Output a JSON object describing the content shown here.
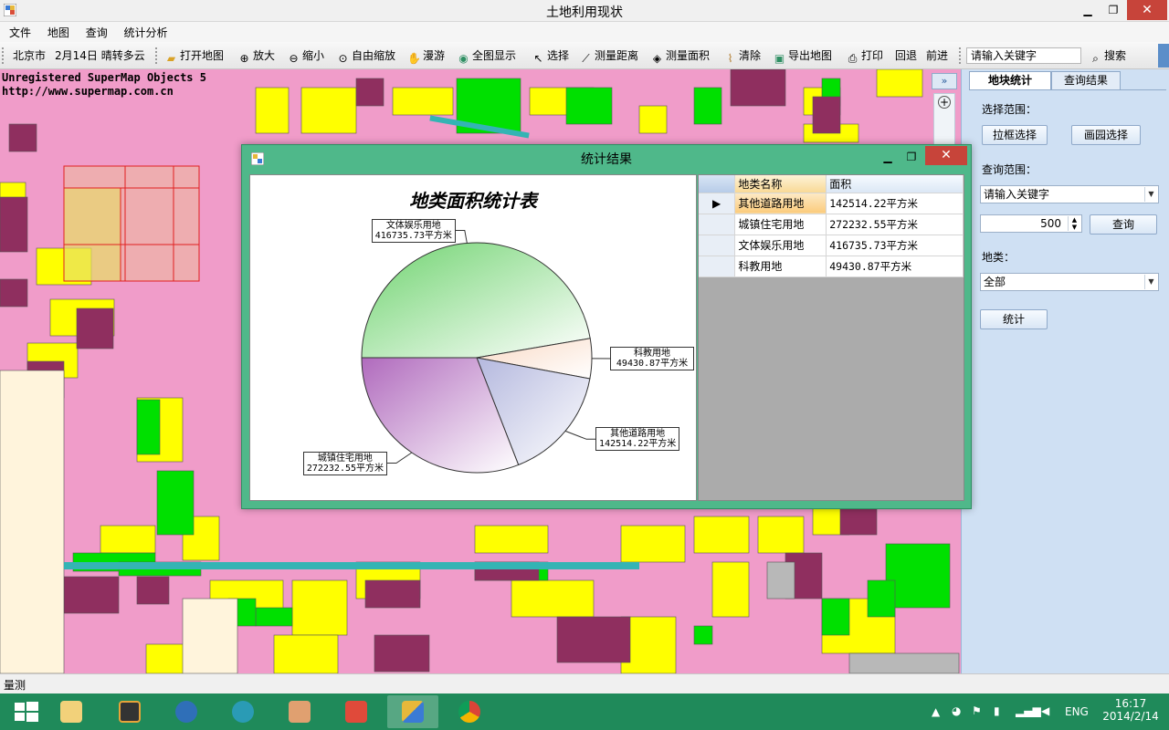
{
  "window": {
    "title": "土地利用现状"
  },
  "menu": [
    "文件",
    "地图",
    "查询",
    "统计分析"
  ],
  "toolbar": {
    "city": "北京市",
    "weather": "2月14日  晴转多云",
    "buttons": [
      "打开地图",
      "放大",
      "缩小",
      "自由缩放",
      "漫游",
      "全图显示",
      "选择",
      "测量距离",
      "测量面积",
      "清除",
      "导出地图",
      "打印",
      "回退",
      "前进"
    ],
    "search_placeholder": "请输入关键字",
    "search_button": "搜索"
  },
  "watermark": {
    "line1": "Unregistered SuperMap Objects 5",
    "line2": "http://www.supermap.com.cn"
  },
  "right_panel": {
    "tabs": [
      "地块统计",
      "查询结果"
    ],
    "select_range_label": "选择范围：",
    "box_select": "拉框选择",
    "circle_select": "画园选择",
    "query_range_label": "查询范围：",
    "query_combo": "请输入关键字",
    "spin_value": "500",
    "query_button": "查询",
    "land_type_label": "地类：",
    "land_type_value": "全部",
    "stat_button": "统计"
  },
  "collapse_label": "»",
  "status": {
    "text": "量测"
  },
  "dialog": {
    "title": "统计结果",
    "grid": {
      "columns": [
        "地类名称",
        "面积"
      ],
      "rows": [
        {
          "name": "其他道路用地",
          "area": "142514.22平方米"
        },
        {
          "name": "城镇住宅用地",
          "area": "272232.55平方米"
        },
        {
          "name": "文体娱乐用地",
          "area": "416735.73平方米"
        },
        {
          "name": "科教用地",
          "area": "49430.87平方米"
        }
      ]
    }
  },
  "chart_data": {
    "type": "pie",
    "title": "地类面积统计表",
    "categories": [
      "文体娱乐用地",
      "科教用地",
      "其他道路用地",
      "城镇住宅用地"
    ],
    "values": [
      416735.73,
      49430.87,
      142514.22,
      272232.55
    ],
    "labels": [
      "416735.73平方米",
      "49430.87平方米",
      "142514.22平方米",
      "272232.55平方米"
    ],
    "colors": [
      "#6fd36f",
      "#f9d9c4",
      "#b4b8de",
      "#b06abd"
    ]
  },
  "taskbar": {
    "time": "16:17",
    "date": "2014/2/14",
    "lang": "ENG"
  }
}
